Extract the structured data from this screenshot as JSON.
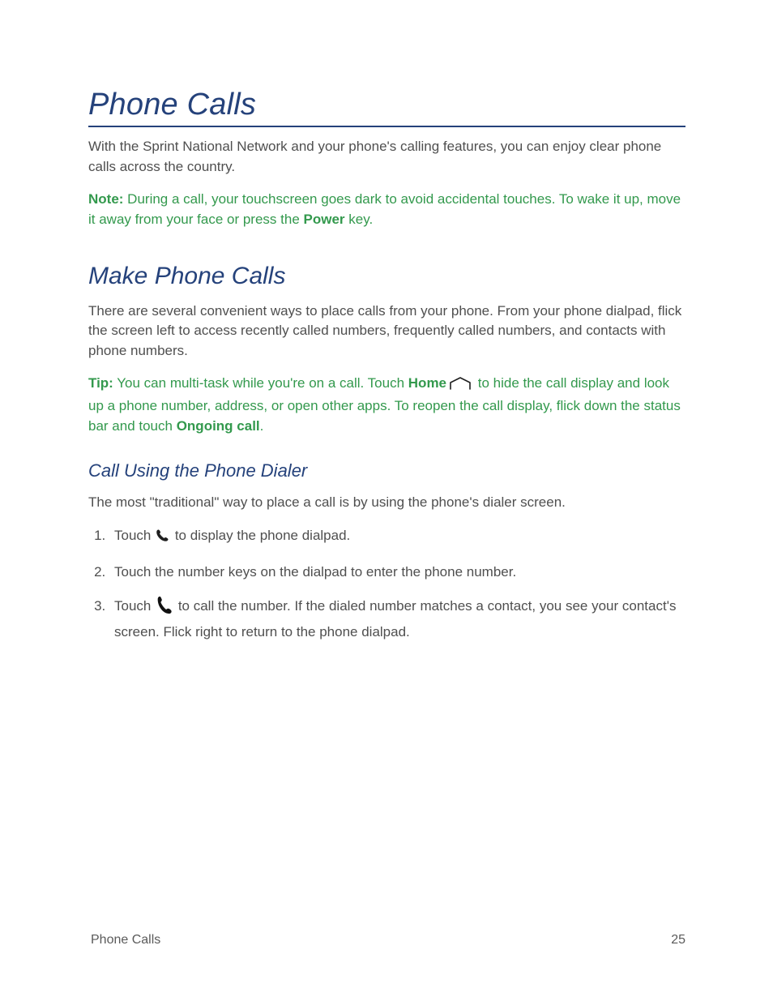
{
  "page": {
    "title": "Phone Calls",
    "intro": "With the Sprint National Network and your phone's calling features, you can enjoy clear phone calls across the country.",
    "note": {
      "label": "Note:",
      "before_power": "  During a call, your touchscreen goes dark to avoid accidental touches. To wake it up, move it away from your face or press the ",
      "power_word": "Power",
      "after_power": " key."
    },
    "section_make": {
      "title": "Make Phone Calls",
      "intro": "There are several convenient ways to place calls from your phone. From your phone dialpad, flick the screen left to access recently called numbers, frequently called numbers, and contacts with phone numbers.",
      "tip": {
        "label": "Tip:",
        "pre_home": " You can multi-task while you're on a call. Touch ",
        "home_word": "Home",
        "post_home_pre_ongoing": " to hide the call display and look up a phone number, address, or open other apps. To reopen the call display, flick down the status bar and touch ",
        "ongoing_word": "Ongoing call",
        "post_ongoing": "."
      }
    },
    "section_dialer": {
      "title": "Call Using the Phone Dialer",
      "intro": "The most \"traditional\" way to place a call is by using the phone's dialer screen.",
      "steps": {
        "s1_pre": "Touch ",
        "s1_post": " to display the phone dialpad.",
        "s2": "Touch the number keys on the dialpad to enter the phone number.",
        "s3_pre": "Touch ",
        "s3_post": " to call the number. If the dialed number matches a contact, you see your contact's screen. Flick right to return to the phone dialpad."
      }
    },
    "footer": {
      "section": "Phone Calls",
      "page_number": "25"
    }
  }
}
